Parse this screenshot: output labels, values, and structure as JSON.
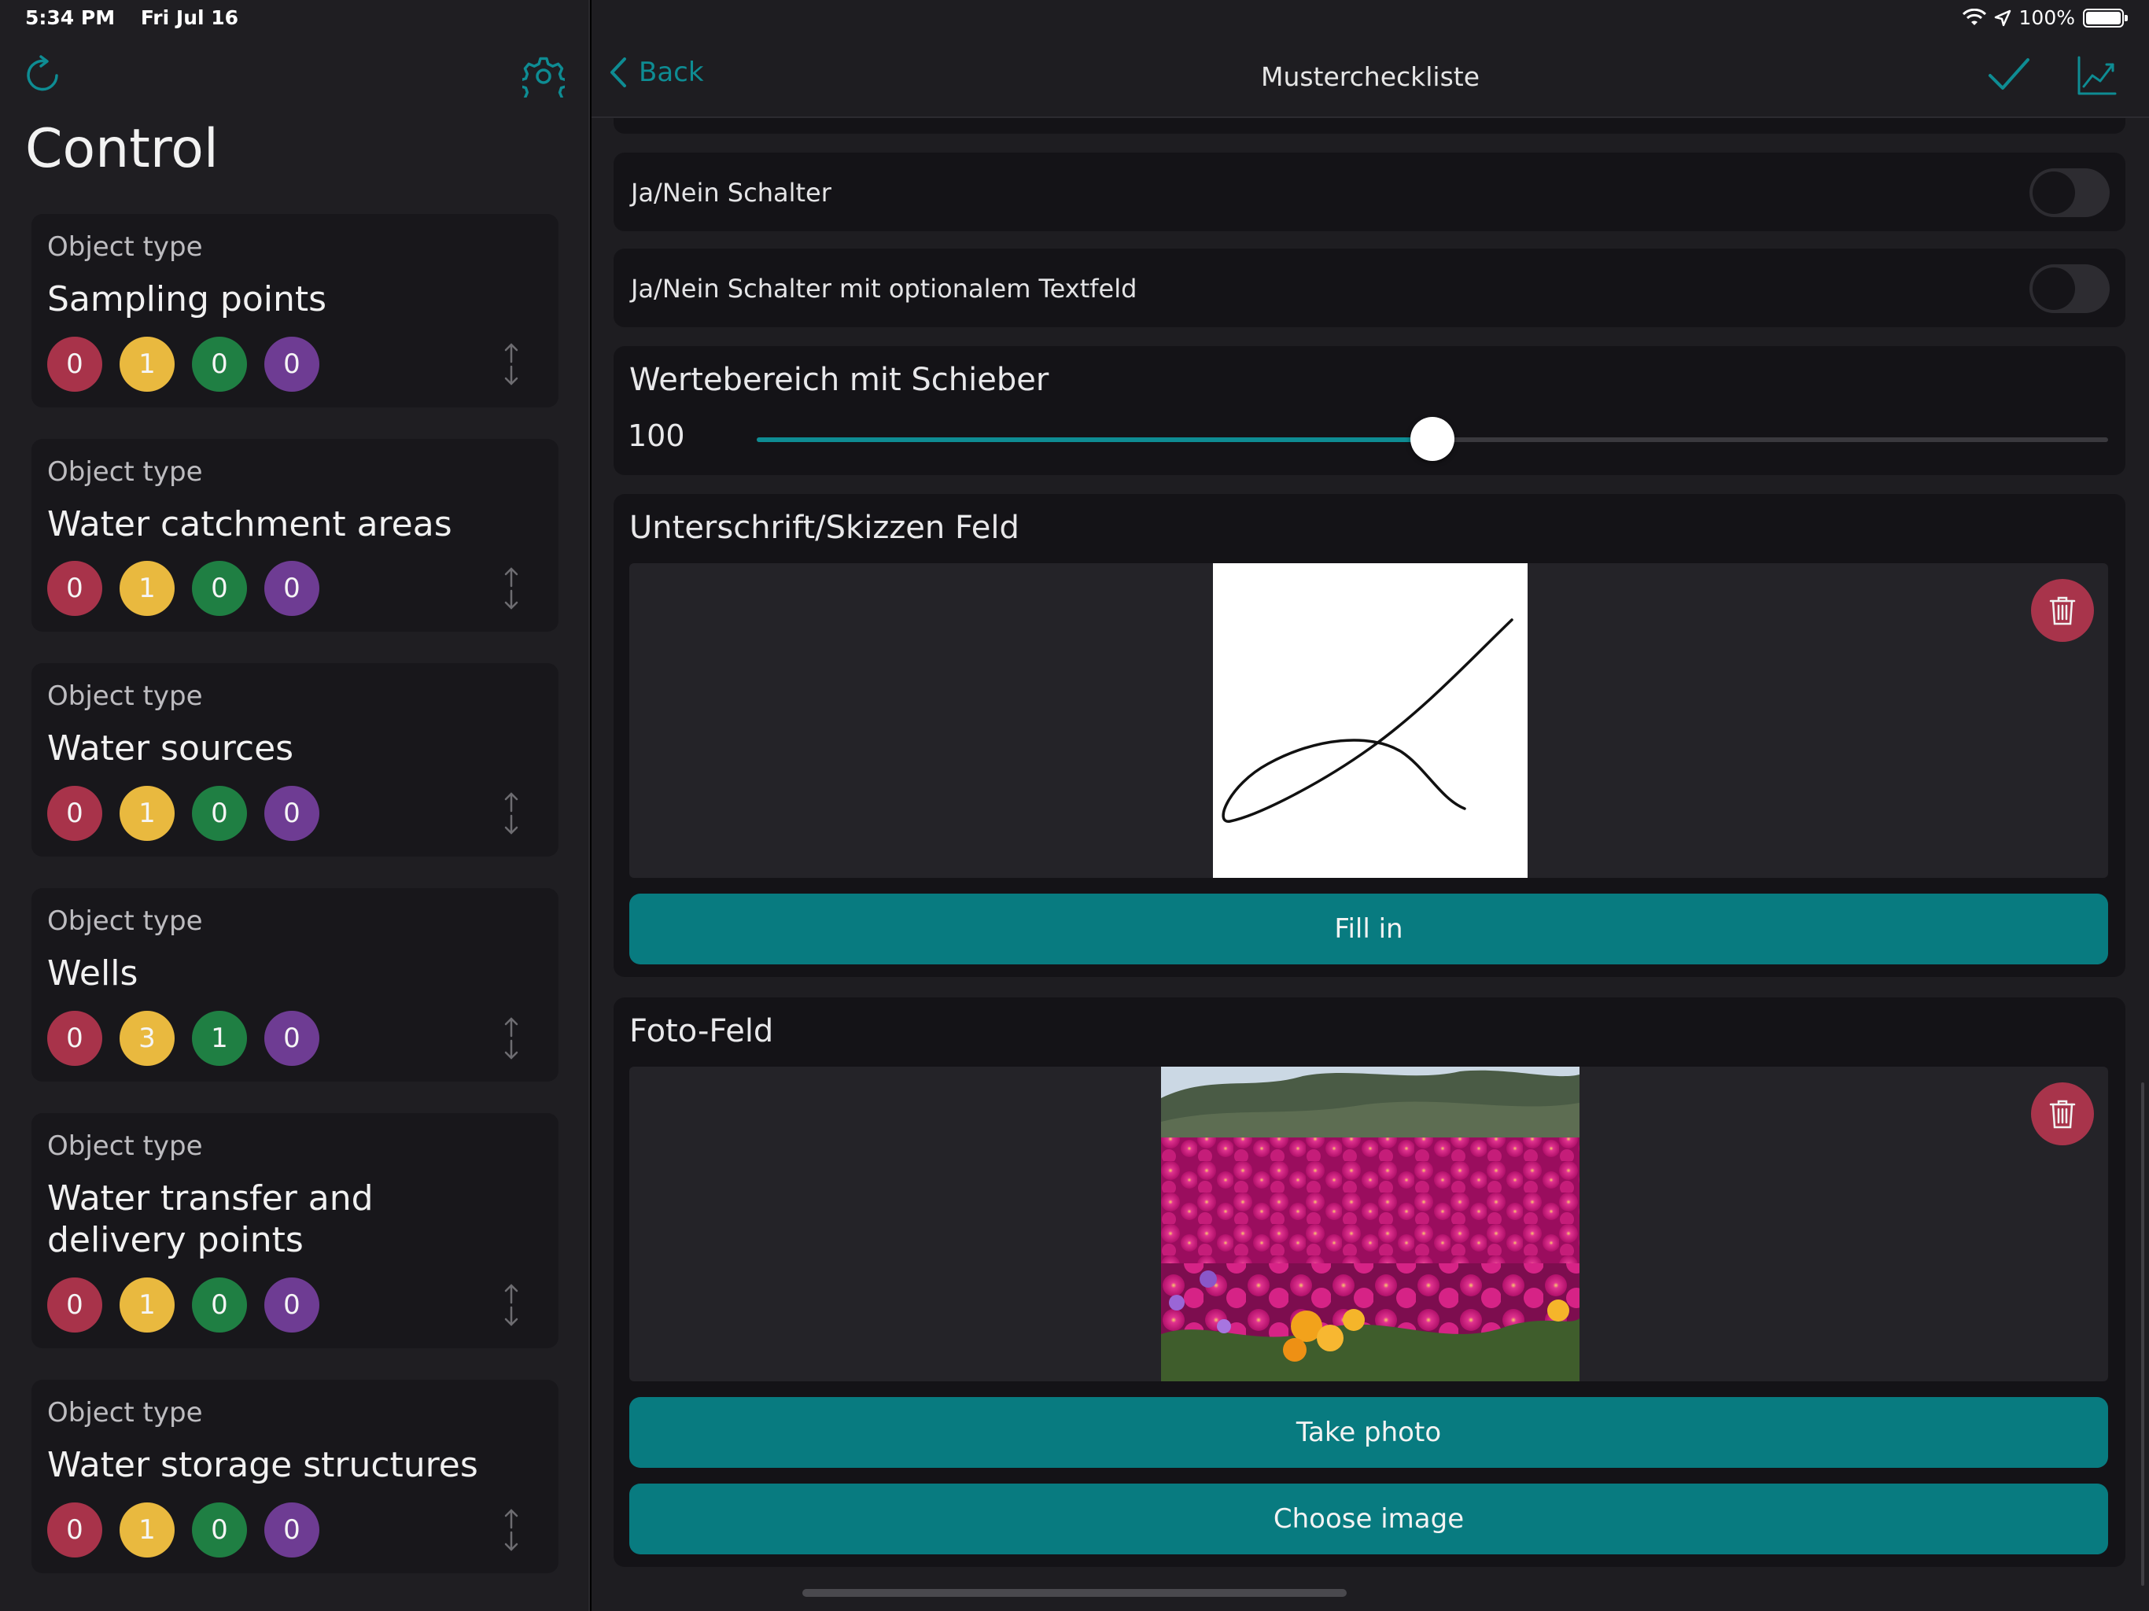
{
  "status": {
    "time": "5:34 PM",
    "date": "Fri Jul 16",
    "battery": "100%"
  },
  "sidebar": {
    "title": "Control",
    "cards": [
      {
        "label": "Object type",
        "name": "Sampling points",
        "counts": [
          "0",
          "1",
          "0",
          "0"
        ]
      },
      {
        "label": "Object type",
        "name": "Water catchment areas",
        "counts": [
          "0",
          "1",
          "0",
          "0"
        ]
      },
      {
        "label": "Object type",
        "name": "Water sources",
        "counts": [
          "0",
          "1",
          "0",
          "0"
        ]
      },
      {
        "label": "Object type",
        "name": "Wells",
        "counts": [
          "0",
          "3",
          "1",
          "0"
        ]
      },
      {
        "label": "Object type",
        "name": "Water transfer and delivery points",
        "counts": [
          "0",
          "1",
          "0",
          "0"
        ]
      },
      {
        "label": "Object type",
        "name": "Water storage structures",
        "counts": [
          "0",
          "1",
          "0",
          "0"
        ]
      }
    ]
  },
  "nav": {
    "back_label": "Back",
    "title": "Mustercheckliste"
  },
  "form": {
    "toggle1_label": "Ja/Nein Schalter",
    "toggle1_on": false,
    "toggle2_label": "Ja/Nein Schalter mit optionalem Textfeld",
    "toggle2_on": false,
    "slider_label": "Wertebereich mit Schieber",
    "slider_value": "100",
    "slider_fraction": 0.5,
    "signature_label": "Unterschrift/Skizzen Feld",
    "fill_in_label": "Fill in",
    "photo_label": "Foto-Feld",
    "take_photo_label": "Take photo",
    "choose_image_label": "Choose image"
  },
  "colors": {
    "accent": "#0e8c93",
    "button": "#087b80",
    "badge_red": "#a8334a",
    "badge_yellow": "#e9b93f",
    "badge_green": "#1f7f43",
    "badge_purple": "#6e3c93",
    "trash": "#a8344b"
  },
  "icons": {
    "refresh": "refresh-icon",
    "settings": "gear-icon",
    "back": "chevron-left-icon",
    "done": "checkmark-icon",
    "chart": "line-chart-icon",
    "delete": "trash-icon",
    "sort": "sort-arrows-icon",
    "wifi": "wifi-icon",
    "location": "location-arrow-icon",
    "battery": "battery-icon"
  }
}
